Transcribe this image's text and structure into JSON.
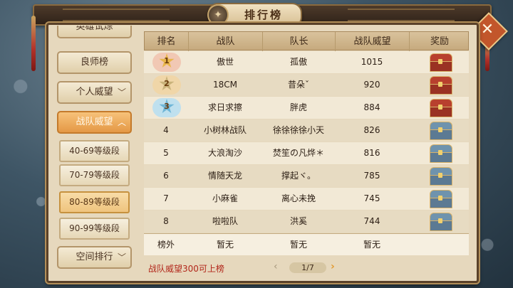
{
  "title": "排行榜",
  "close_label": "✕",
  "sidebar": {
    "top_cut_label": "英雄试炼",
    "items": [
      {
        "label": "良师榜",
        "chevron": ""
      },
      {
        "label": "个人威望",
        "chevron": "﹀"
      },
      {
        "label": "战队威望",
        "chevron": "︿",
        "active": true
      },
      {
        "label": "空间排行",
        "chevron": "﹀"
      }
    ],
    "sub_items": [
      {
        "label": "40-69等级段"
      },
      {
        "label": "70-79等级段"
      },
      {
        "label": "80-89等级段",
        "active": true
      },
      {
        "label": "90-99等级段"
      }
    ]
  },
  "table": {
    "headers": [
      "排名",
      "战队",
      "队长",
      "战队威望",
      "奖励"
    ],
    "rows": [
      {
        "rank": "1",
        "team": "傲世",
        "captain": "孤傲",
        "prestige": "1015",
        "reward_icon": "red-gold-chest-icon"
      },
      {
        "rank": "2",
        "team": "18CM",
        "captain": "昔朵ˇ",
        "prestige": "920",
        "reward_icon": "red-gold-chest-icon"
      },
      {
        "rank": "3",
        "team": "求日求擦",
        "captain": "胖虎",
        "prestige": "884",
        "reward_icon": "red-chest-icon"
      },
      {
        "rank": "4",
        "team": "小树林战队",
        "captain": "徐徐徐徐小天",
        "prestige": "826",
        "reward_icon": "blue-chest-icon"
      },
      {
        "rank": "5",
        "team": "大浪淘沙",
        "captain": "焚笙の凡烨＊",
        "prestige": "816",
        "reward_icon": "blue-chest-icon"
      },
      {
        "rank": "6",
        "team": "情随天龙",
        "captain": "撑起ヾ。",
        "prestige": "785",
        "reward_icon": "blue-chest-icon"
      },
      {
        "rank": "7",
        "team": "小麻雀",
        "captain": "离心未挽",
        "prestige": "745",
        "reward_icon": "blue-chest-icon"
      },
      {
        "rank": "8",
        "team": "啦啦队",
        "captain": "洪奚",
        "prestige": "744",
        "reward_icon": "blue-chest-icon"
      }
    ],
    "footer": {
      "rank": "榜外",
      "team": "暂无",
      "captain": "暂无",
      "prestige": "暂无"
    }
  },
  "hint": "战队威望300可上榜",
  "pager": {
    "prev": "‹",
    "page": "1/7",
    "next": "›"
  },
  "colors": {
    "gold": "#e8b64a",
    "silver": "#c9b27a",
    "bronze": "#6fb6d8",
    "chest_red": "#b8402e",
    "chest_blue": "#6f93ad",
    "hint_red": "#b2261a"
  }
}
